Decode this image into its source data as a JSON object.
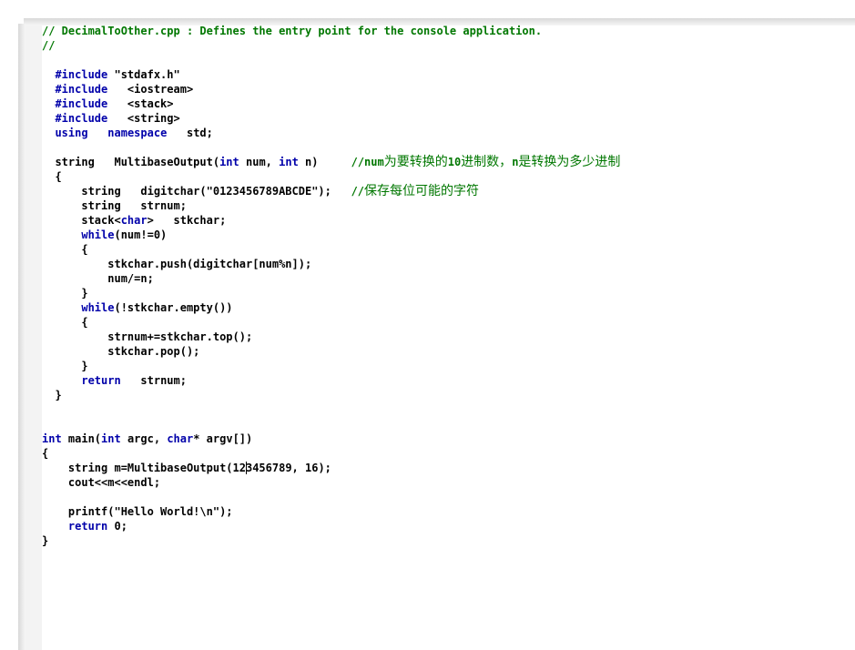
{
  "editor": {
    "lines": [
      {
        "segs": [
          {
            "t": "// DecimalToOther.cpp : Defines the entry point for the console application.",
            "c": "cm"
          }
        ]
      },
      {
        "segs": [
          {
            "t": "//",
            "c": "cm"
          }
        ]
      },
      {
        "segs": []
      },
      {
        "segs": [
          {
            "t": "  "
          },
          {
            "t": "#include",
            "c": "kw"
          },
          {
            "t": " \"stdafx.h\""
          }
        ]
      },
      {
        "segs": [
          {
            "t": "  "
          },
          {
            "t": "#include",
            "c": "kw"
          },
          {
            "t": "   <iostream>"
          }
        ]
      },
      {
        "segs": [
          {
            "t": "  "
          },
          {
            "t": "#include",
            "c": "kw"
          },
          {
            "t": "   <stack>"
          }
        ]
      },
      {
        "segs": [
          {
            "t": "  "
          },
          {
            "t": "#include",
            "c": "kw"
          },
          {
            "t": "   <string>"
          }
        ]
      },
      {
        "segs": [
          {
            "t": "  "
          },
          {
            "t": "using",
            "c": "kw"
          },
          {
            "t": "   "
          },
          {
            "t": "namespace",
            "c": "kw"
          },
          {
            "t": "   std;"
          }
        ]
      },
      {
        "segs": []
      },
      {
        "segs": [
          {
            "t": "  string   MultibaseOutput("
          },
          {
            "t": "int",
            "c": "kw"
          },
          {
            "t": " num, "
          },
          {
            "t": "int",
            "c": "kw"
          },
          {
            "t": " n)     "
          },
          {
            "t": "//num",
            "c": "cm"
          },
          {
            "t": "为要转换的",
            "c": "cmcn"
          },
          {
            "t": "10",
            "c": "cm"
          },
          {
            "t": "进制数，",
            "c": "cmcn"
          },
          {
            "t": "n",
            "c": "cm"
          },
          {
            "t": "是转换为多少进制",
            "c": "cmcn"
          }
        ]
      },
      {
        "segs": [
          {
            "t": "  {"
          }
        ]
      },
      {
        "segs": [
          {
            "t": "      string   digitchar(\"0123456789ABCDE\");   "
          },
          {
            "t": "//",
            "c": "cm"
          },
          {
            "t": "保存每位可能的字符",
            "c": "cmcn"
          }
        ]
      },
      {
        "segs": [
          {
            "t": "      string   strnum;"
          }
        ]
      },
      {
        "segs": [
          {
            "t": "      stack<"
          },
          {
            "t": "char",
            "c": "kw"
          },
          {
            "t": ">   stkchar;"
          }
        ]
      },
      {
        "segs": [
          {
            "t": "      "
          },
          {
            "t": "while",
            "c": "kw"
          },
          {
            "t": "(num!=0)"
          }
        ]
      },
      {
        "segs": [
          {
            "t": "      {"
          }
        ]
      },
      {
        "segs": [
          {
            "t": "          stkchar.push(digitchar[num%n]);"
          }
        ]
      },
      {
        "segs": [
          {
            "t": "          num/=n;"
          }
        ]
      },
      {
        "segs": [
          {
            "t": "      }"
          }
        ]
      },
      {
        "segs": [
          {
            "t": "      "
          },
          {
            "t": "while",
            "c": "kw"
          },
          {
            "t": "(!stkchar.empty())"
          }
        ]
      },
      {
        "segs": [
          {
            "t": "      {"
          }
        ]
      },
      {
        "segs": [
          {
            "t": "          strnum+=stkchar.top();"
          }
        ]
      },
      {
        "segs": [
          {
            "t": "          stkchar.pop();"
          }
        ]
      },
      {
        "segs": [
          {
            "t": "      }"
          }
        ]
      },
      {
        "segs": [
          {
            "t": "      "
          },
          {
            "t": "return",
            "c": "kw"
          },
          {
            "t": "   strnum;"
          }
        ]
      },
      {
        "segs": [
          {
            "t": "  }"
          }
        ]
      },
      {
        "segs": []
      },
      {
        "segs": []
      },
      {
        "segs": [
          {
            "t": "int",
            "c": "kw"
          },
          {
            "t": " main("
          },
          {
            "t": "int",
            "c": "kw"
          },
          {
            "t": " argc, "
          },
          {
            "t": "char",
            "c": "kw"
          },
          {
            "t": "* argv[])"
          }
        ]
      },
      {
        "segs": [
          {
            "t": "{"
          }
        ]
      },
      {
        "segs": [
          {
            "t": "    string m=MultibaseOutput(12"
          },
          {
            "t": "",
            "c": "caret"
          },
          {
            "t": "3456789, 16);"
          }
        ]
      },
      {
        "segs": [
          {
            "t": "    cout<<m<<endl;"
          }
        ]
      },
      {
        "segs": []
      },
      {
        "segs": [
          {
            "t": "    printf(\"Hello World!\\n\");"
          }
        ]
      },
      {
        "segs": [
          {
            "t": "    "
          },
          {
            "t": "return",
            "c": "kw"
          },
          {
            "t": " 0;"
          }
        ]
      },
      {
        "segs": [
          {
            "t": "}"
          }
        ]
      }
    ]
  }
}
